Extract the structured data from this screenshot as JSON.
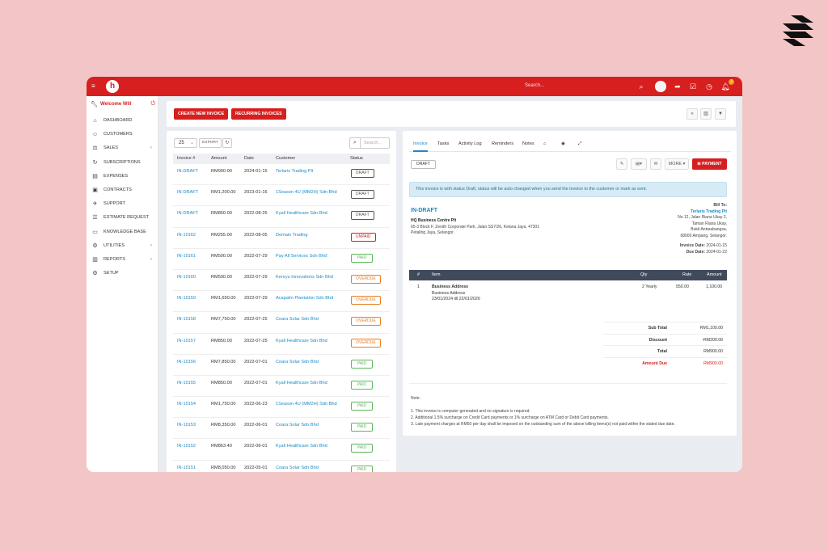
{
  "topbar": {
    "search_placeholder": "Search...",
    "notification_count": "3"
  },
  "sidebar": {
    "welcome": "Welcome Will",
    "items": [
      {
        "label": "DASHBOARD",
        "icon": "home-icon",
        "chevron": false
      },
      {
        "label": "CUSTOMERS",
        "icon": "user-icon",
        "chevron": false
      },
      {
        "label": "SALES",
        "icon": "scale-icon",
        "chevron": true
      },
      {
        "label": "SUBSCRIPTIONS",
        "icon": "refresh-icon",
        "chevron": false
      },
      {
        "label": "EXPENSES",
        "icon": "file-icon",
        "chevron": false
      },
      {
        "label": "CONTRACTS",
        "icon": "contract-icon",
        "chevron": false
      },
      {
        "label": "SUPPORT",
        "icon": "ticket-icon",
        "chevron": false
      },
      {
        "label": "ESTIMATE REQUEST",
        "icon": "list-icon",
        "chevron": false
      },
      {
        "label": "KNOWLEDGE BASE",
        "icon": "folder-icon",
        "chevron": false
      },
      {
        "label": "UTILITIES",
        "icon": "cogs-icon",
        "chevron": true
      },
      {
        "label": "REPORTS",
        "icon": "chart-icon",
        "chevron": true
      },
      {
        "label": "SETUP",
        "icon": "gear-icon",
        "chevron": false
      }
    ]
  },
  "actions": {
    "create_invoice": "CREATE NEW INVOICE",
    "recurring_invoices": "RECURRING INVOICES"
  },
  "list": {
    "page_size": "25",
    "export": "EXPORT",
    "search_placeholder": "Search...",
    "columns": [
      "Invoice #",
      "Amount",
      "Date",
      "Customer",
      "Status"
    ],
    "rows": [
      {
        "invoice": "IN-DRAFT",
        "amount": "RM900.00",
        "date": "2024-01-15",
        "customer": "Terlaris Trading Plt",
        "status": "DRAFT",
        "color": "#555555"
      },
      {
        "invoice": "IN-DRAFT",
        "amount": "RM1,200.00",
        "date": "2023-01-16",
        "customer": "1Season 4U (MM2H) Sdn Bhd",
        "status": "DRAFT",
        "color": "#555555"
      },
      {
        "invoice": "IN-DRAFT",
        "amount": "RM850.00",
        "date": "2022-08-25",
        "customer": "Kyall Healthcare Sdn Bhd",
        "status": "DRAFT",
        "color": "#555555"
      },
      {
        "invoice": "IN-10162",
        "amount": "RM255.00",
        "date": "2022-08-05",
        "customer": "Demain Trading",
        "status": "UNPAID",
        "color": "#d71f1f"
      },
      {
        "invoice": "IN-10161",
        "amount": "RM500.00",
        "date": "2022-07-29",
        "customer": "Pay All Services Sdn Bhd",
        "status": "PAID",
        "color": "#5cb85c"
      },
      {
        "invoice": "IN-10160",
        "amount": "RM500.00",
        "date": "2022-07-29",
        "customer": "Kenryu Innovations Sdn Bhd",
        "status": "OVERDUE",
        "color": "#e67e22"
      },
      {
        "invoice": "IN-10159",
        "amount": "RM1,650.00",
        "date": "2022-07-29",
        "customer": "Acapalm Plantation Sdn Bhd",
        "status": "OVERDUE",
        "color": "#e67e22"
      },
      {
        "invoice": "IN-10158",
        "amount": "RM7,750.00",
        "date": "2022-07-25",
        "customer": "Coara Solar Sdn Bhd",
        "status": "OVERDUE",
        "color": "#e67e22"
      },
      {
        "invoice": "IN-10157",
        "amount": "RM850.00",
        "date": "2022-07-25",
        "customer": "Kyall Healthcare Sdn Bhd",
        "status": "OVERDUE",
        "color": "#e67e22"
      },
      {
        "invoice": "IN-10156",
        "amount": "RM7,850.00",
        "date": "2022-07-01",
        "customer": "Coara Solar Sdn Bhd",
        "status": "PAID",
        "color": "#5cb85c"
      },
      {
        "invoice": "IN-10155",
        "amount": "RM850.00",
        "date": "2022-07-01",
        "customer": "Kyall Healthcare Sdn Bhd",
        "status": "PAID",
        "color": "#5cb85c"
      },
      {
        "invoice": "IN-10154",
        "amount": "RM1,750.00",
        "date": "2022-06-23",
        "customer": "1Season 4U (MM2H) Sdn Bhd",
        "status": "PAID",
        "color": "#5cb85c"
      },
      {
        "invoice": "IN-10153",
        "amount": "RM8,350.00",
        "date": "2022-06-01",
        "customer": "Coara Solar Sdn Bhd",
        "status": "PAID",
        "color": "#5cb85c"
      },
      {
        "invoice": "IN-10152",
        "amount": "RM863.40",
        "date": "2022-06-01",
        "customer": "Kyall Healthcare Sdn Bhd",
        "status": "PAID",
        "color": "#5cb85c"
      },
      {
        "invoice": "IN-10151",
        "amount": "RM8,050.00",
        "date": "2022-05-01",
        "customer": "Coara Solar Sdn Bhd",
        "status": "PAID",
        "color": "#5cb85c"
      }
    ]
  },
  "detail": {
    "tabs": [
      "Invoice",
      "Tasks",
      "Activity Log",
      "Reminders",
      "Notes"
    ],
    "status_chip": "DRAFT",
    "more": "MORE",
    "payment": "PAYMENT",
    "alert": "This invoice is with status Draft, status will be auto changed when you send the invoice to the customer or mark as sent.",
    "invoice_number": "IN-DRAFT",
    "from": {
      "company": "HQ Business Centre Plt",
      "line1": "65-3 Block F, Zenith Corporate Park, Jalan SS7/26, Kelana Jaya, 47301",
      "line2": "Petaling Jaya, Selangor."
    },
    "bill_to": {
      "label": "Bill To:",
      "company": "Terlaris Trading Plt",
      "line1": "No 12, Jalan Riana Ukay 2,",
      "line2": "Taman Riana Ukay,",
      "line3": "Bukit Antarabangsa,",
      "line4": "68000 Ampang, Selangor.",
      "invoice_date_label": "Invoice Date:",
      "invoice_date": "2024-01-15",
      "due_date_label": "Due Date:",
      "due_date": "2024-01-22"
    },
    "item_columns": [
      "#",
      "Item",
      "Qty",
      "Rate",
      "Amount"
    ],
    "items": [
      {
        "no": "1",
        "name": "Business Address",
        "desc1": "Business Address",
        "desc2": "23/01/2024 till 22/01/2026",
        "qty": "2 Yearly",
        "rate": "550.00",
        "amount": "1,100.00"
      }
    ],
    "totals": {
      "subtotal_label": "Sub Total",
      "subtotal": "RM1,100.00",
      "discount_label": "Discount",
      "discount": "-RM200.00",
      "total_label": "Total",
      "total": "RM900.00",
      "due_label": "Amount Due",
      "due": "RM900.00"
    },
    "note_label": "Note:",
    "notes": [
      "1. This invoice is computer generated and no signature is required.",
      "2. Additional 1.5% surcharge on Credit Card payments or 1% surcharge on ATM Card or Debit Card payments.",
      "3. Late payment charges at RM50 per day shall be imposed on the outstanding sum of the above billing items(s) not paid within the stated due date."
    ]
  }
}
